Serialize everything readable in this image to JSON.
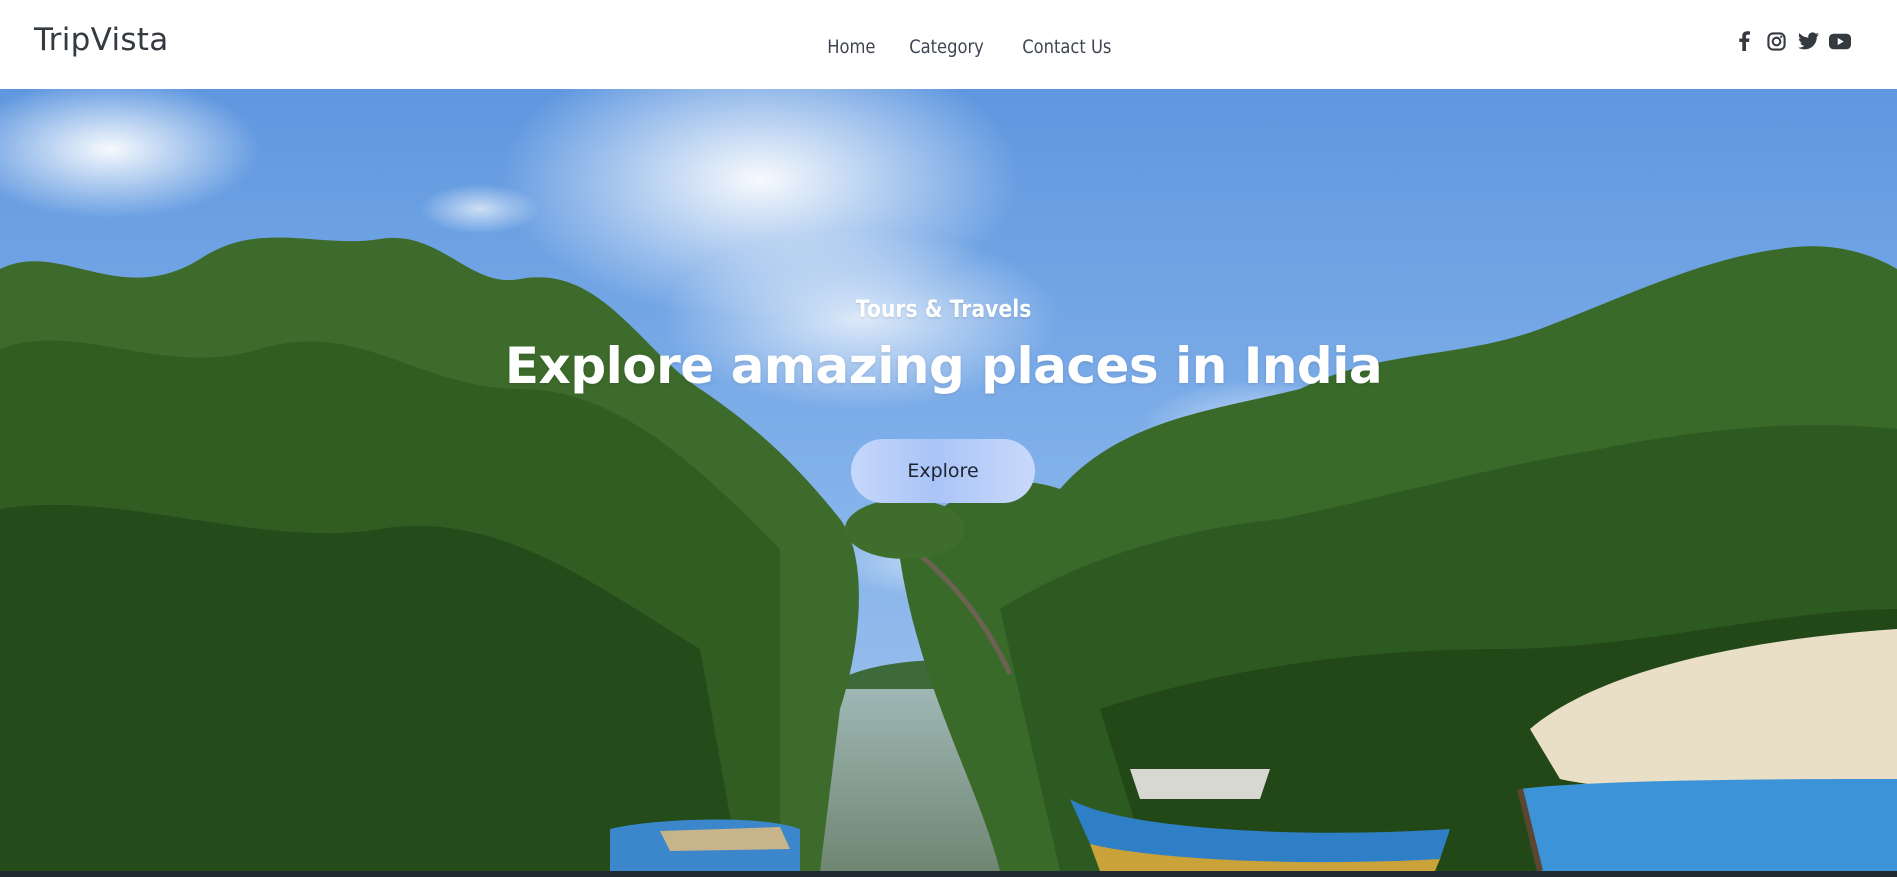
{
  "header": {
    "brand": "TripVista",
    "nav": [
      {
        "label": "Home"
      },
      {
        "label": "Category"
      },
      {
        "label": "Contact Us"
      }
    ],
    "socials": [
      "facebook-icon",
      "instagram-icon",
      "twitter-icon",
      "youtube-icon"
    ]
  },
  "hero": {
    "subtitle": "Tours & Travels",
    "headline": "Explore amazing places in India",
    "cta_label": "Explore",
    "background": "mangrove-river-with-boats-photo"
  },
  "colors": {
    "text_dark": "#343a40",
    "nav_text": "#3f4550",
    "sky": "#6fa3e3",
    "button_bg": "#b3cbf9",
    "hero_text": "#ffffff"
  }
}
